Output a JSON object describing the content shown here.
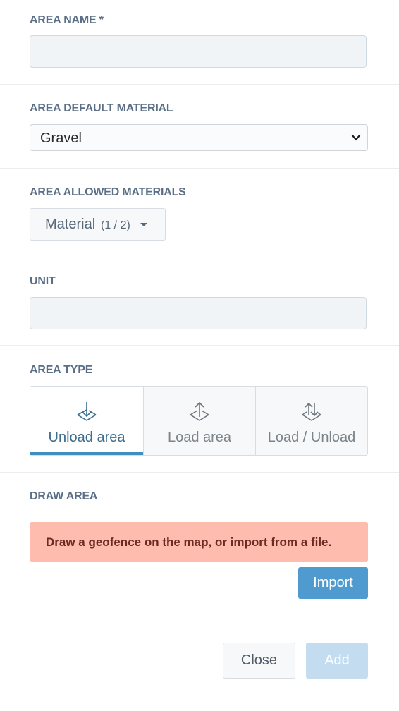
{
  "area_name": {
    "label": "AREA NAME *",
    "value": ""
  },
  "default_material": {
    "label": "AREA DEFAULT MATERIAL",
    "selected": "Gravel"
  },
  "allowed_materials": {
    "label": "AREA ALLOWED MATERIALS",
    "button_label": "Material",
    "count": "(1 / 2)"
  },
  "unit": {
    "label": "UNIT",
    "value": ""
  },
  "area_type": {
    "label": "AREA TYPE",
    "options": [
      {
        "label": "Unload area",
        "icon": "arrow-down-into-plane-icon",
        "active": true
      },
      {
        "label": "Load area",
        "icon": "arrow-up-from-plane-icon",
        "active": false
      },
      {
        "label": "Load / Unload",
        "icon": "arrows-up-down-plane-icon",
        "active": false
      }
    ],
    "active_color": "#3e8fbd"
  },
  "draw_area": {
    "label": "DRAW AREA",
    "alert_text": "Draw a geofence on the map, or import from a file.",
    "import_label": "Import"
  },
  "footer": {
    "close_label": "Close",
    "add_label": "Add"
  },
  "colors": {
    "label": "#5a6f86",
    "alert_bg": "#fdbcad",
    "primary": "#4f9acf",
    "primary_disabled": "#c3dcef"
  }
}
